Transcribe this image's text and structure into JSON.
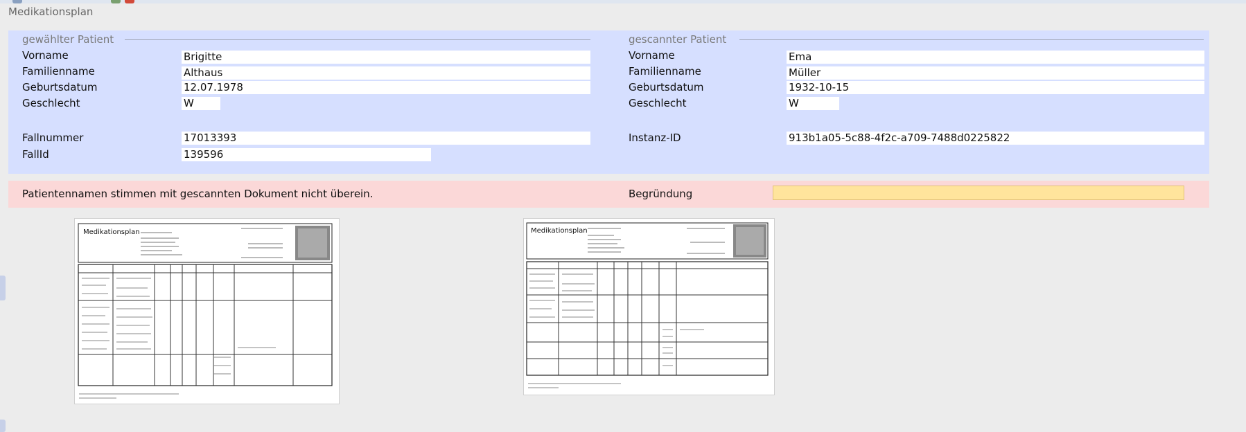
{
  "window": {
    "title": "Medikationsplan"
  },
  "selected_patient": {
    "legend": "gewählter Patient",
    "labels": {
      "first_name": "Vorname",
      "last_name": "Familienname",
      "birth_date": "Geburtsdatum",
      "sex": "Geschlecht",
      "case_number": "Fallnummer",
      "case_id": "FallId"
    },
    "values": {
      "first_name": "Brigitte",
      "last_name": "Althaus",
      "birth_date": "12.07.1978",
      "sex": "W",
      "case_number": "17013393",
      "case_id": "139596"
    }
  },
  "scanned_patient": {
    "legend": "gescannter Patient",
    "labels": {
      "first_name": "Vorname",
      "last_name": "Familienname",
      "birth_date": "Geburtsdatum",
      "sex": "Geschlecht",
      "instance_id": "Instanz-ID"
    },
    "values": {
      "first_name": "Ema",
      "last_name": "Müller",
      "birth_date": "1932-10-15",
      "sex": "W",
      "instance_id": "913b1a05-5c88-4f2c-a709-7488d0225822"
    }
  },
  "mismatch": {
    "message": "Patientennamen stimmen mit gescannten Dokument nicht überein.",
    "reason_label": "Begründung",
    "reason_value": ""
  },
  "scans": {
    "left": {
      "heading": "Medikationsplan"
    },
    "right": {
      "heading": "Medikationsplan"
    }
  },
  "colors": {
    "panel": "#d6dfff",
    "error": "#fbd8d8",
    "reason_field": "#ffe49c"
  }
}
